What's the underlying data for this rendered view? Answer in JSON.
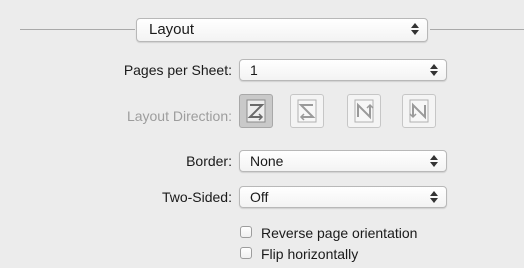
{
  "section_menu": {
    "selected": "Layout"
  },
  "pages_per_sheet": {
    "label": "Pages per Sheet:",
    "value": "1"
  },
  "layout_direction": {
    "label": "Layout Direction:",
    "options": [
      {
        "icon": "z-direction-icon",
        "selected": true
      },
      {
        "icon": "s-direction-icon",
        "selected": false
      },
      {
        "icon": "n-reverse-direction-icon",
        "selected": false
      },
      {
        "icon": "n-direction-icon",
        "selected": false
      }
    ]
  },
  "border": {
    "label": "Border:",
    "value": "None"
  },
  "two_sided": {
    "label": "Two-Sided:",
    "value": "Off"
  },
  "checkboxes": {
    "reverse": {
      "label": "Reverse page orientation",
      "checked": false
    },
    "flip": {
      "label": "Flip horizontally",
      "checked": false
    }
  }
}
